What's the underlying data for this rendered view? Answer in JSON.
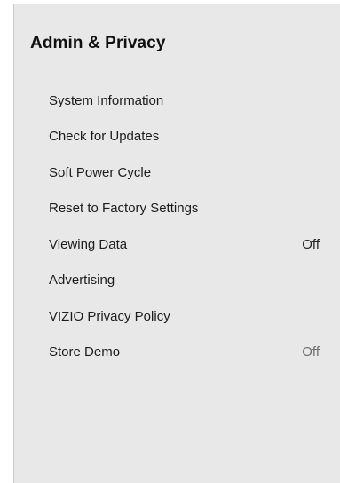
{
  "menu": {
    "title": "Admin & Privacy",
    "items": [
      {
        "label": "System Information",
        "value": null
      },
      {
        "label": "Check for Updates",
        "value": null
      },
      {
        "label": "Soft Power Cycle",
        "value": null
      },
      {
        "label": "Reset to Factory Settings",
        "value": null
      },
      {
        "label": "Viewing Data",
        "value": "Off"
      },
      {
        "label": "Advertising",
        "value": null
      },
      {
        "label": "VIZIO Privacy Policy",
        "value": null
      },
      {
        "label": "Store Demo",
        "value": "Off"
      }
    ]
  },
  "colors": {
    "panel_background": "#e8e8e8",
    "text_primary": "#1c1c1c",
    "text_muted": "#6f6f6f"
  }
}
